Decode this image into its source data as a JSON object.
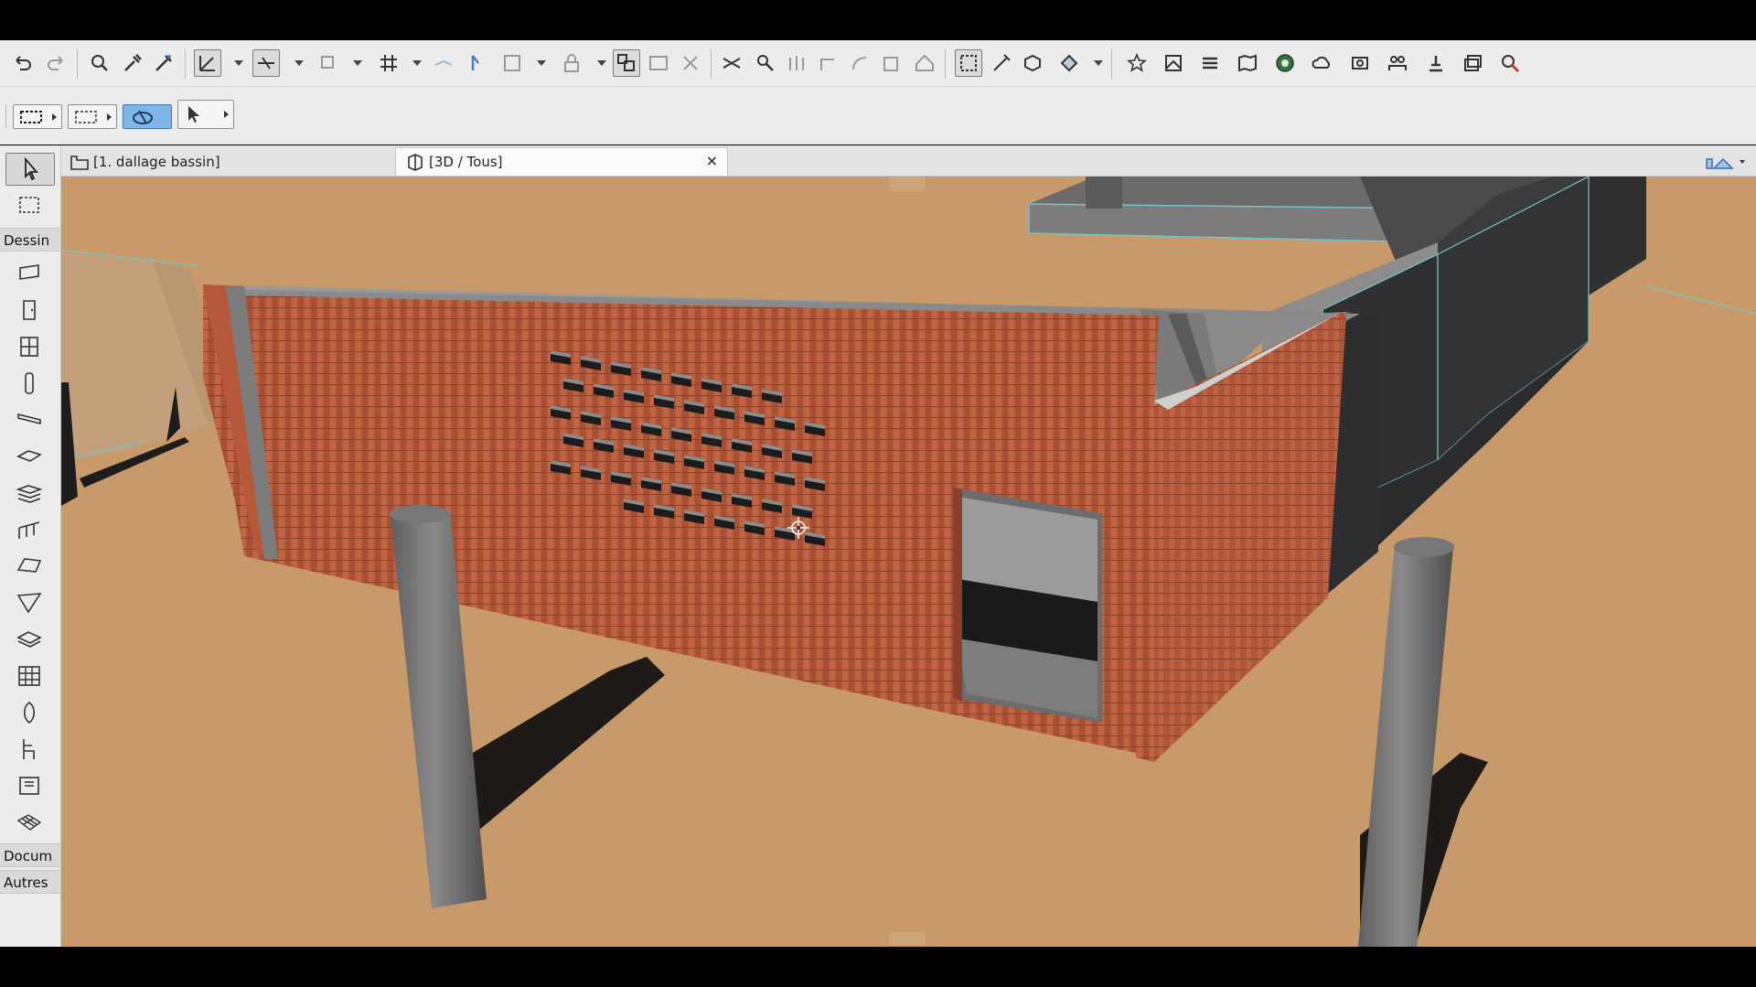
{
  "tabs": [
    {
      "label": "[1. dallage bassin]",
      "active": false
    },
    {
      "label": "[3D / Tous]",
      "active": true
    }
  ],
  "tab_close_symbol": "×",
  "toolbox": {
    "groups": [
      "Dessin",
      "Docum",
      "Autres"
    ]
  },
  "toolbar_icons": [
    "undo-icon",
    "redo-icon",
    "find-select-icon",
    "eyedropper-icon",
    "syringe-icon",
    "guide-lines-icon",
    "snap-guide-icon",
    "align-icon",
    "grid-snap-icon",
    "layer-icon",
    "pick-icon",
    "box-icon",
    "lock-icon",
    "suspend-groups-icon",
    "trim-icon",
    "explode-icon",
    "split-icon",
    "adjust-icon",
    "elevate-icon",
    "intersect-icon",
    "fillet-icon",
    "offset-icon",
    "roof-icon",
    "3d-window-icon",
    "pen-icon",
    "3d-style-icon",
    "navigation-icon",
    "favorites-icon",
    "layout-icon",
    "stories-icon",
    "map-icon",
    "render-icon",
    "cloud-icon",
    "publish-icon",
    "teamwork-icon",
    "reserve-icon",
    "stack-icon",
    "bim-icon"
  ],
  "colors": {
    "ground": "#c89a6a",
    "brick": "#b65a34",
    "concrete": "#8a8a8a",
    "dark_wall": "#2f3032",
    "selection_outline": "#6fc7c9",
    "toolbar_bg": "#ececec",
    "active_blue": "#7fb6e6"
  }
}
